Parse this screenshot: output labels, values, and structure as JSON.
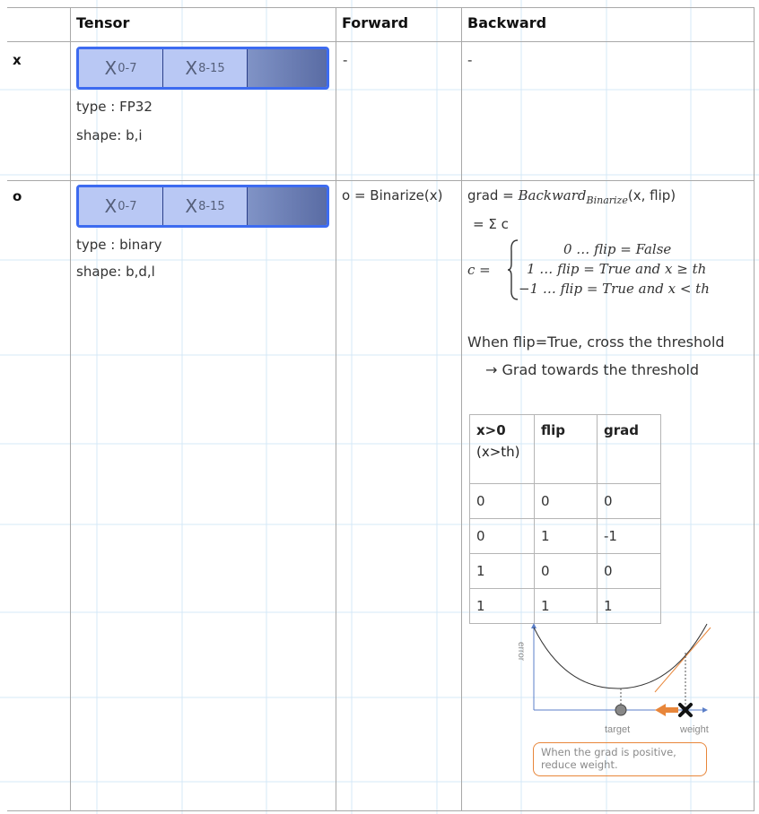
{
  "headers": {
    "tensor": "Tensor",
    "forward": "Forward",
    "backward": "Backward"
  },
  "rows": {
    "x": {
      "label": "x",
      "seg1": "X",
      "seg1_sub": "0-7",
      "seg2": "X",
      "seg2_sub": "8-15",
      "type": "type : FP32",
      "shape": "shape: b,i",
      "forward": "-",
      "backward": "-"
    },
    "o": {
      "label": "o",
      "seg1": "X",
      "seg1_sub": "0-7",
      "seg2": "X",
      "seg2_sub": "8-15",
      "type": "type : binary",
      "shape": "shape: b,d,l",
      "forward": "o = Binarize(x)"
    }
  },
  "backward": {
    "grad_prefix": "grad = ",
    "grad_fn": "Backward",
    "grad_fn_sub": "Binarize",
    "grad_args": "(x, flip)",
    "sum_line": "= Σ c",
    "c_label": "c  =",
    "cases": [
      "0 … flip = False",
      "1 … flip = True and x ≥ th",
      "−1 … flip = True and x < th"
    ],
    "explain1": "When flip=True, cross the threshold",
    "explain2": "→ Grad towards the threshold"
  },
  "truth_table": {
    "headers": [
      "x>0",
      "flip",
      "grad"
    ],
    "header_sub": "(x>th)",
    "rows": [
      [
        "0",
        "0",
        "0"
      ],
      [
        "0",
        "1",
        "-1"
      ],
      [
        "1",
        "0",
        "0"
      ],
      [
        "1",
        "1",
        "1"
      ]
    ]
  },
  "diagram": {
    "ylabel": "error",
    "target_label": "target",
    "weight_label": "weight",
    "note": "When the grad is positive, reduce weight.",
    "curve_color": "#333333",
    "tangent_color": "#e8863a",
    "arrow_color": "#e8863a",
    "axis_color": "#5b7fc8"
  }
}
